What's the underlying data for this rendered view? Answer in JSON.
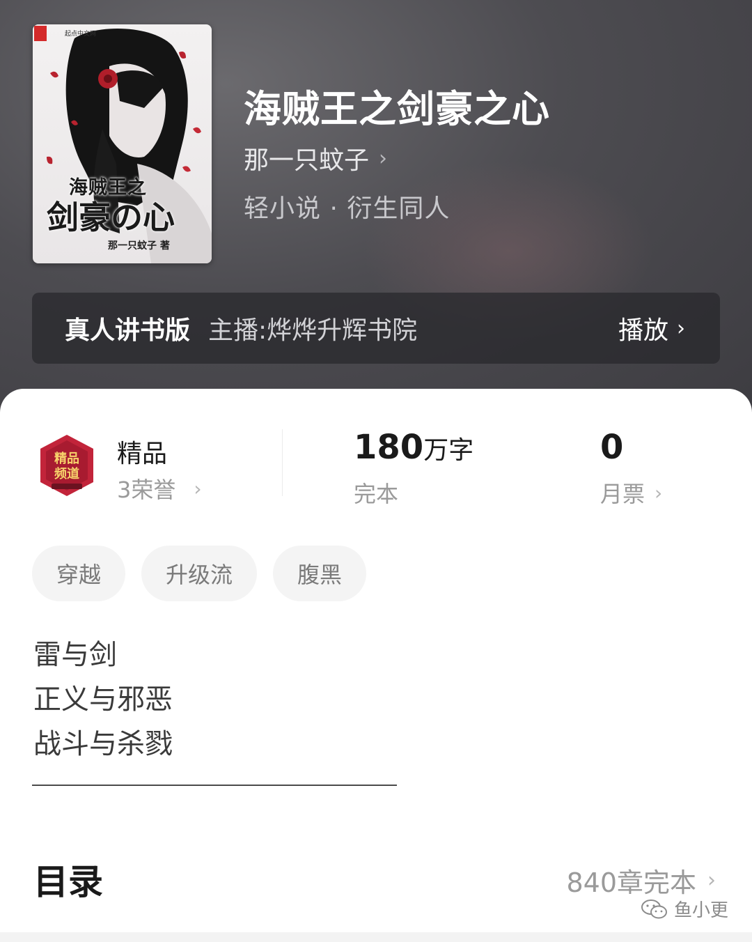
{
  "book": {
    "title": "海贼王之剑豪之心",
    "author": "那一只蚊子",
    "category": "轻小说 · 衍生同人"
  },
  "cover": {
    "publisher": "起点中文网",
    "title_line1": "海贼王之",
    "title_line2": "剑豪の心",
    "author_credit": "那一只蚊子 著"
  },
  "audio": {
    "label": "真人讲书版",
    "host": "主播:烨烨升辉书院",
    "play": "播放"
  },
  "stats": {
    "badge_label": "精品",
    "badge_text": "精品频道",
    "honors": "3荣誉",
    "words_number": "180",
    "words_unit": "万字",
    "status": "完本",
    "tickets_value": "0",
    "tickets_label": "月票"
  },
  "tags": [
    "穿越",
    "升级流",
    "腹黑"
  ],
  "description": [
    "雷与剑",
    "正义与邪恶",
    "战斗与杀戮"
  ],
  "toc": {
    "title": "目录",
    "count": "840章完本"
  },
  "watermark": "鱼小更",
  "colors": {
    "hero_bg": "#4d4c51",
    "badge_red": "#c2243a",
    "tag_bg": "#f4f4f4"
  }
}
